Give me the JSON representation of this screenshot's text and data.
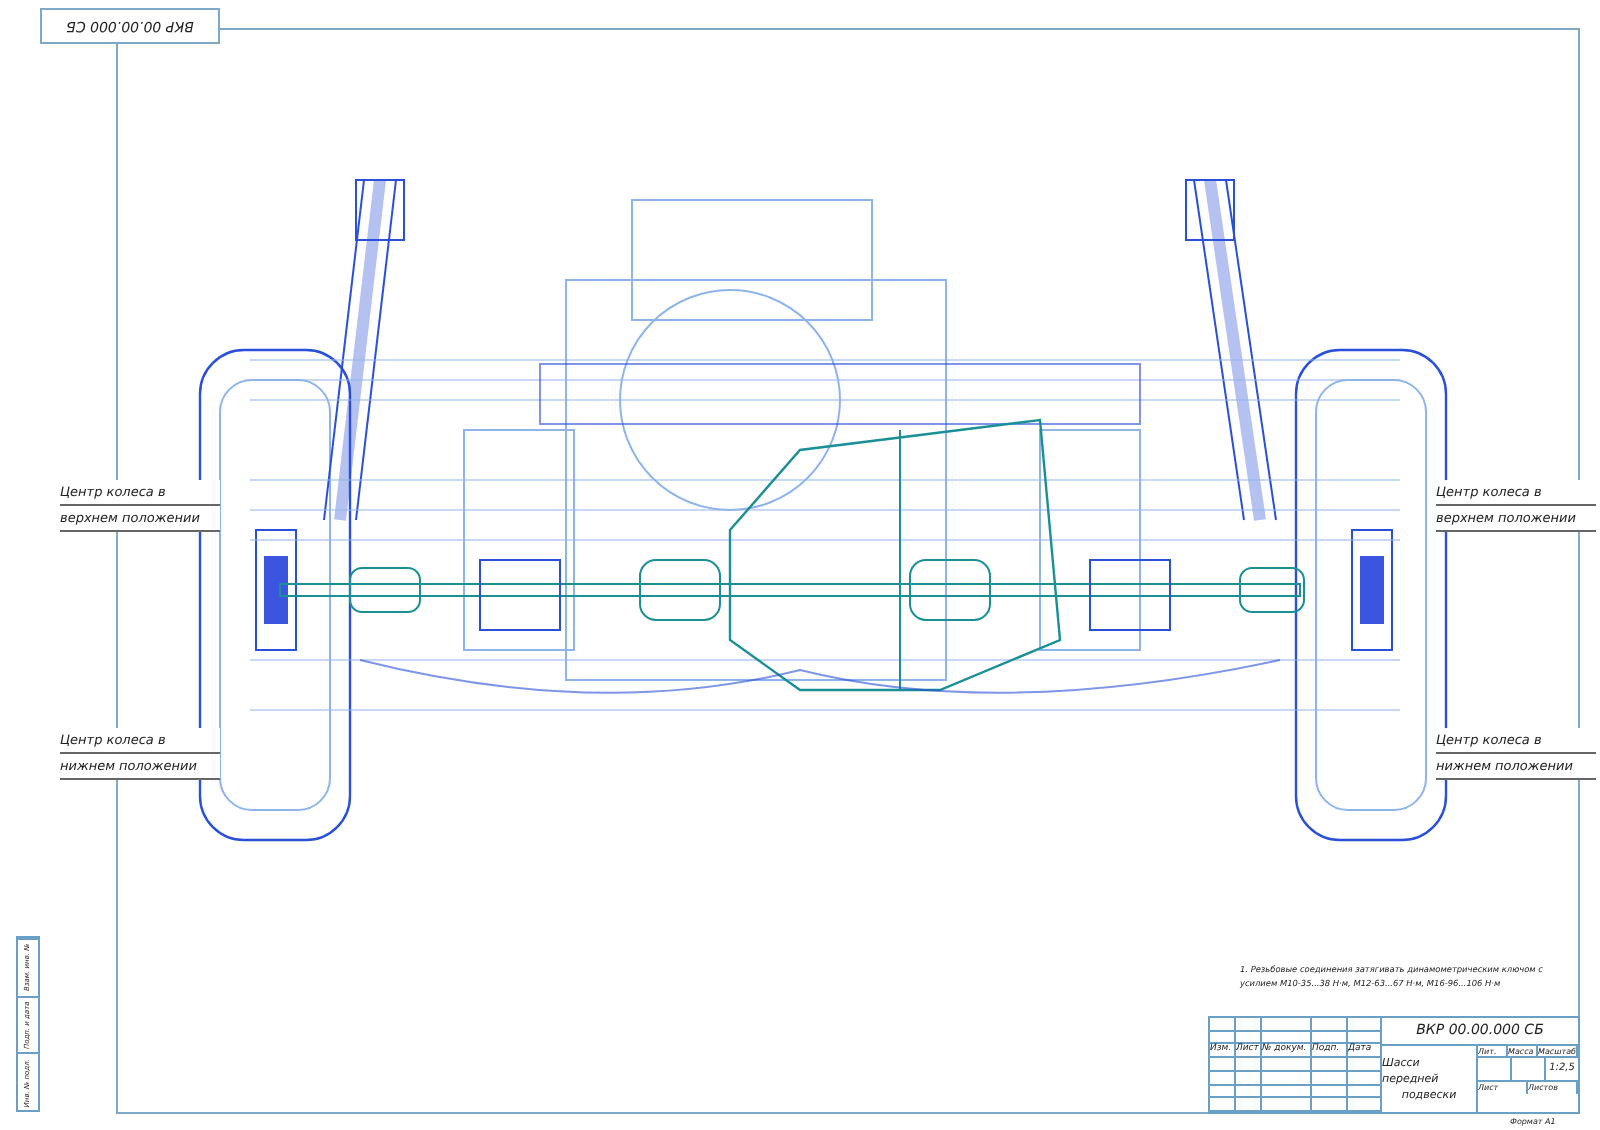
{
  "sheet_code": "ВКР 00.00.000 СБ",
  "labels": [
    {
      "lines": [
        "Центр колеса в",
        "верхнем положении"
      ]
    },
    {
      "lines": [
        "Центр колеса в",
        "нижнем положении"
      ]
    },
    {
      "lines": [
        "Центр колеса в",
        "верхнем положении"
      ]
    },
    {
      "lines": [
        "Центр колеса в",
        "нижнем положении"
      ]
    }
  ],
  "note": [
    "1. Резьбовые соединения затягивать динамометрическим ключом с",
    "усилием М10-35...38 Н·м, М12-63...67 Н·м, М16-96...106 Н·м"
  ],
  "title_block": {
    "designation": "ВКР 00.00.000 СБ",
    "name": [
      "Шасси передней",
      "подвески"
    ],
    "change_headers": [
      "Изм.",
      "Лист",
      "№ докум.",
      "Подп.",
      "Дата"
    ],
    "info_headers": [
      "Лит.",
      "Масса",
      "Масштаб"
    ],
    "scale": "1:2,5",
    "sheet_headers": [
      "Лист",
      "Листов"
    ]
  },
  "side_stamps": [
    "Инв. № подл.",
    "Подп. и дата",
    "Взам. инв. №"
  ],
  "format": "Формат А1"
}
